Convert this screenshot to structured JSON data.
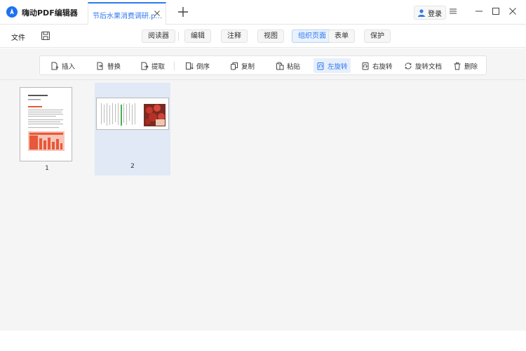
{
  "titlebar": {
    "app_title": "嗨动PDF编辑器",
    "doc_tab_label": "节后水果消费调研.p...",
    "login_label": "登录"
  },
  "menubar": {
    "file_label": "文件",
    "tabs": [
      {
        "label": "阅读器"
      },
      {
        "label": "编辑"
      },
      {
        "label": "注释"
      },
      {
        "label": "视图"
      },
      {
        "label": "组织页面"
      },
      {
        "label": "表单"
      },
      {
        "label": "保护"
      }
    ],
    "active_tab": "组织页面"
  },
  "toolbar": {
    "items": [
      {
        "label": "插入",
        "icon": "insert-page-icon"
      },
      {
        "label": "替换",
        "icon": "replace-page-icon"
      },
      {
        "label": "提取",
        "icon": "extract-page-icon"
      },
      {
        "label": "倒序",
        "icon": "reverse-order-icon"
      },
      {
        "label": "复制",
        "icon": "copy-icon"
      },
      {
        "label": "粘贴",
        "icon": "paste-icon"
      },
      {
        "label": "左旋转",
        "icon": "rotate-left-icon"
      },
      {
        "label": "右旋转",
        "icon": "rotate-right-icon"
      },
      {
        "label": "旋转文档",
        "icon": "rotate-document-icon"
      },
      {
        "label": "删除",
        "icon": "trash-icon"
      }
    ],
    "active_item": "左旋转"
  },
  "pages": [
    {
      "number": "1",
      "orientation": "portrait",
      "selected": false
    },
    {
      "number": "2",
      "orientation": "landscape",
      "selected": true
    }
  ],
  "colors": {
    "accent": "#2f78ee",
    "selection_bg": "#e1e9f6",
    "workspace_bg": "#f5f5f5",
    "thumbnail_chart": "#e8583a"
  }
}
